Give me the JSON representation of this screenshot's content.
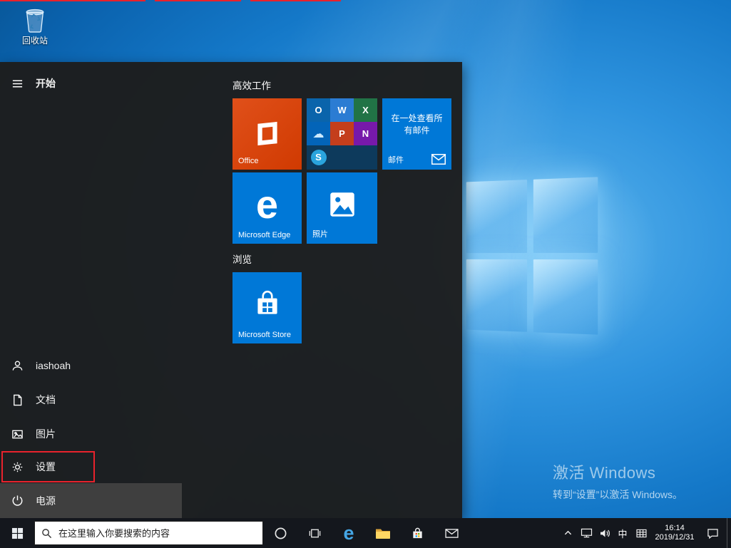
{
  "colors": {
    "tile_blue": "#0078d7",
    "office_orange": "#d83b01",
    "annotation_red": "#e8222c"
  },
  "desktop": {
    "recycle_bin_label": "回收站",
    "activation_line1": "激活 Windows",
    "activation_line2": "转到“设置”以激活 Windows。"
  },
  "start": {
    "header": "开始",
    "rail": {
      "user": "iashoah",
      "documents": "文档",
      "pictures": "图片",
      "settings": "设置",
      "power": "电源"
    },
    "groups": {
      "productivity": "高效工作",
      "explore": "浏览"
    },
    "tiles": {
      "office_label": "Office",
      "mail_title": "在一处查看所有邮件",
      "mail_label": "邮件",
      "edge_letter": "e",
      "edge_label": "Microsoft Edge",
      "photos_label": "照片",
      "store_label": "Microsoft Store"
    },
    "mini": {
      "outlook": "O",
      "word": "W",
      "excel": "X",
      "onedrive": "☁",
      "powerpoint": "P",
      "onenote": "N",
      "skype": "S"
    }
  },
  "taskbar": {
    "search_placeholder": "在这里输入你要搜索的内容",
    "edge_letter": "e",
    "tray": {
      "ime": "中",
      "time": "16:14",
      "date": "2019/12/31"
    }
  }
}
